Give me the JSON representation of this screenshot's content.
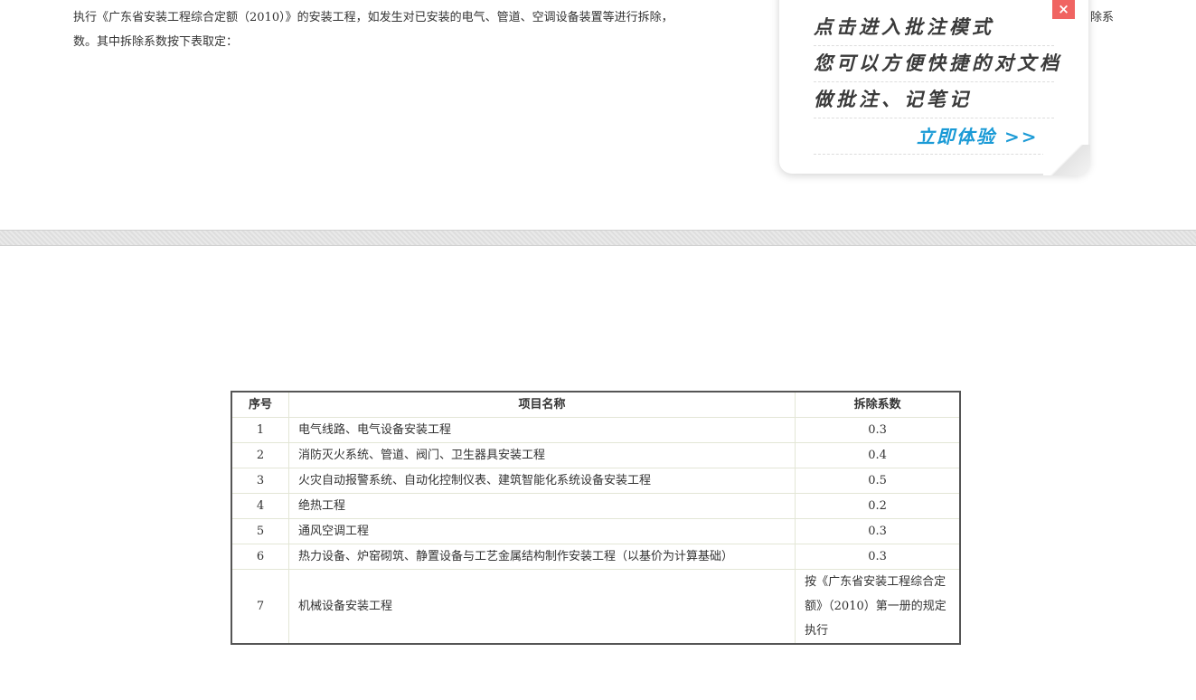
{
  "document": {
    "paragraph_lines": [
      "执行《广东省安装工程综合定额（2010）》的安装工程，如发生对已安装的电气、管道、空调设备装置等进行拆除，",
      "数。其中拆除系数按下表取定："
    ],
    "paragraph_tail": "除系"
  },
  "annotation_popup": {
    "lines": [
      "点击进入批注模式",
      "您可以方便快捷的对文档",
      "做批注、记笔记"
    ],
    "try_link": "立即体验 >>",
    "close_label": "×"
  },
  "table": {
    "headers": [
      "序号",
      "项目名称",
      "拆除系数"
    ],
    "rows": [
      {
        "no": "1",
        "name": "电气线路、电气设备安装工程",
        "coef": "0.3"
      },
      {
        "no": "2",
        "name": "消防灭火系统、管道、阀门、卫生器具安装工程",
        "coef": "0.4"
      },
      {
        "no": "3",
        "name": "火灾自动报警系统、自动化控制仪表、建筑智能化系统设备安装工程",
        "coef": "0.5"
      },
      {
        "no": "4",
        "name": "绝热工程",
        "coef": "0.2"
      },
      {
        "no": "5",
        "name": "通风空调工程",
        "coef": "0.3"
      },
      {
        "no": "6",
        "name": "热力设备、炉窑砌筑、静置设备与工艺金属结构制作安装工程（以基价为计算基础）",
        "coef": "0.3"
      },
      {
        "no": "7",
        "name": "机械设备安装工程",
        "coef": "按《广东省安装工程综合定额》（2010）第一册的规定执行"
      }
    ]
  },
  "colors": {
    "accent_link": "#1a9ad6",
    "close_button": "#f06462",
    "table_border": "#555555"
  }
}
